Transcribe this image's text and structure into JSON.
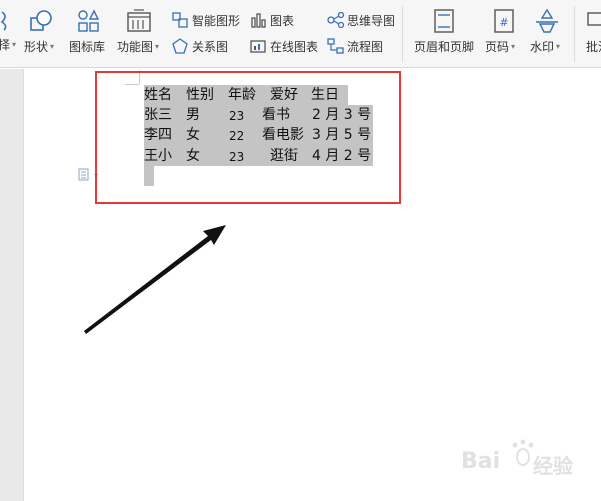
{
  "ribbon": {
    "partial_left_label": "择",
    "shape": {
      "label": "形状"
    },
    "icon_library": {
      "label": "图标库"
    },
    "function_chart": {
      "label": "功能图"
    },
    "smart_graphic": {
      "label": "智能图形"
    },
    "chart": {
      "label": "图表"
    },
    "mind_map": {
      "label": "思维导图"
    },
    "relation_chart": {
      "label": "关系图"
    },
    "online_chart": {
      "label": "在线图表"
    },
    "flowchart": {
      "label": "流程图"
    },
    "header_footer": {
      "label": "页眉和页脚"
    },
    "page_number": {
      "label": "页码"
    },
    "watermark": {
      "label": "水印"
    },
    "partial_right_label": "批注"
  },
  "table": {
    "headers": [
      "姓名",
      "性别",
      "年龄",
      "爱好",
      "生日"
    ],
    "rows": [
      [
        "张三",
        "男",
        "23",
        "看书",
        "2 月 3 号"
      ],
      [
        "李四",
        "女",
        "22",
        "看电影",
        "3 月 5 号"
      ],
      [
        "王小",
        "女",
        "23",
        "逛街",
        "4 月 2 号"
      ]
    ]
  },
  "watermark_text": {
    "brand": "Bai",
    "suffix": "经验"
  },
  "colors": {
    "highlight_box": "#e53935",
    "selection": "#c4c4c4",
    "arrow": "#111111"
  }
}
